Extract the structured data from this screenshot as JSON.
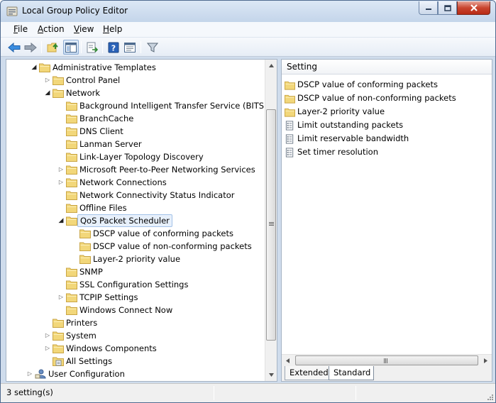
{
  "window": {
    "title": "Local Group Policy Editor"
  },
  "menu": [
    {
      "label": "File",
      "accel": "F",
      "rest": "ile"
    },
    {
      "label": "Action",
      "accel": "A",
      "rest": "ction"
    },
    {
      "label": "View",
      "accel": "V",
      "rest": "iew"
    },
    {
      "label": "Help",
      "accel": "H",
      "rest": "elp"
    }
  ],
  "toolbar": {
    "buttons": [
      "back-arrow-icon",
      "forward-arrow-icon",
      "up-folder-icon",
      "show-hide-tree-icon",
      "export-list-icon",
      "help-icon",
      "properties-icon",
      "filter-icon"
    ]
  },
  "tree": {
    "items": [
      {
        "label": "Administrative Templates",
        "level": 1,
        "toggle": "expanded",
        "icon": "folder"
      },
      {
        "label": "Control Panel",
        "level": 2,
        "toggle": "collapsed",
        "icon": "folder"
      },
      {
        "label": "Network",
        "level": 2,
        "toggle": "expanded",
        "icon": "folder"
      },
      {
        "label": "Background Intelligent Transfer Service (BITS)",
        "level": 3,
        "toggle": "none",
        "icon": "folder"
      },
      {
        "label": "BranchCache",
        "level": 3,
        "toggle": "none",
        "icon": "folder"
      },
      {
        "label": "DNS Client",
        "level": 3,
        "toggle": "none",
        "icon": "folder"
      },
      {
        "label": "Lanman Server",
        "level": 3,
        "toggle": "none",
        "icon": "folder"
      },
      {
        "label": "Link-Layer Topology Discovery",
        "level": 3,
        "toggle": "none",
        "icon": "folder"
      },
      {
        "label": "Microsoft Peer-to-Peer Networking Services",
        "level": 3,
        "toggle": "collapsed",
        "icon": "folder"
      },
      {
        "label": "Network Connections",
        "level": 3,
        "toggle": "collapsed",
        "icon": "folder"
      },
      {
        "label": "Network Connectivity Status Indicator",
        "level": 3,
        "toggle": "none",
        "icon": "folder"
      },
      {
        "label": "Offline Files",
        "level": 3,
        "toggle": "none",
        "icon": "folder"
      },
      {
        "label": "QoS Packet Scheduler",
        "level": 3,
        "toggle": "expanded",
        "icon": "folder-open",
        "selected": true
      },
      {
        "label": "DSCP value of conforming packets",
        "level": 4,
        "toggle": "none",
        "icon": "folder"
      },
      {
        "label": "DSCP value of non-conforming packets",
        "level": 4,
        "toggle": "none",
        "icon": "folder"
      },
      {
        "label": "Layer-2 priority value",
        "level": 4,
        "toggle": "none",
        "icon": "folder"
      },
      {
        "label": "SNMP",
        "level": 3,
        "toggle": "none",
        "icon": "folder"
      },
      {
        "label": "SSL Configuration Settings",
        "level": 3,
        "toggle": "none",
        "icon": "folder"
      },
      {
        "label": "TCPIP Settings",
        "level": 3,
        "toggle": "collapsed",
        "icon": "folder"
      },
      {
        "label": "Windows Connect Now",
        "level": 3,
        "toggle": "none",
        "icon": "folder"
      },
      {
        "label": "Printers",
        "level": 2,
        "toggle": "none",
        "icon": "folder"
      },
      {
        "label": "System",
        "level": 2,
        "toggle": "collapsed",
        "icon": "folder"
      },
      {
        "label": "Windows Components",
        "level": 2,
        "toggle": "collapsed",
        "icon": "folder"
      },
      {
        "label": "All Settings",
        "level": 2,
        "toggle": "none",
        "icon": "settings-folder"
      },
      {
        "label": "User Configuration",
        "level": 0,
        "toggle": "collapsed",
        "icon": "user"
      }
    ]
  },
  "list": {
    "column_header": "Setting",
    "items": [
      {
        "label": "DSCP value of conforming packets",
        "icon": "folder"
      },
      {
        "label": "DSCP value of non-conforming packets",
        "icon": "folder"
      },
      {
        "label": "Layer-2 priority value",
        "icon": "folder"
      },
      {
        "label": "Limit outstanding packets",
        "icon": "policy-setting"
      },
      {
        "label": "Limit reservable bandwidth",
        "icon": "policy-setting"
      },
      {
        "label": "Set timer resolution",
        "icon": "policy-setting"
      }
    ]
  },
  "tabs": {
    "extended": "Extended",
    "standard": "Standard",
    "active": "Standard"
  },
  "status": {
    "text": "3 setting(s)"
  },
  "colors": {
    "folder": "#f2d77a",
    "folder_edge": "#c9a544",
    "selection": "#e7f0fb",
    "accent_blue": "#2a6fc9"
  }
}
